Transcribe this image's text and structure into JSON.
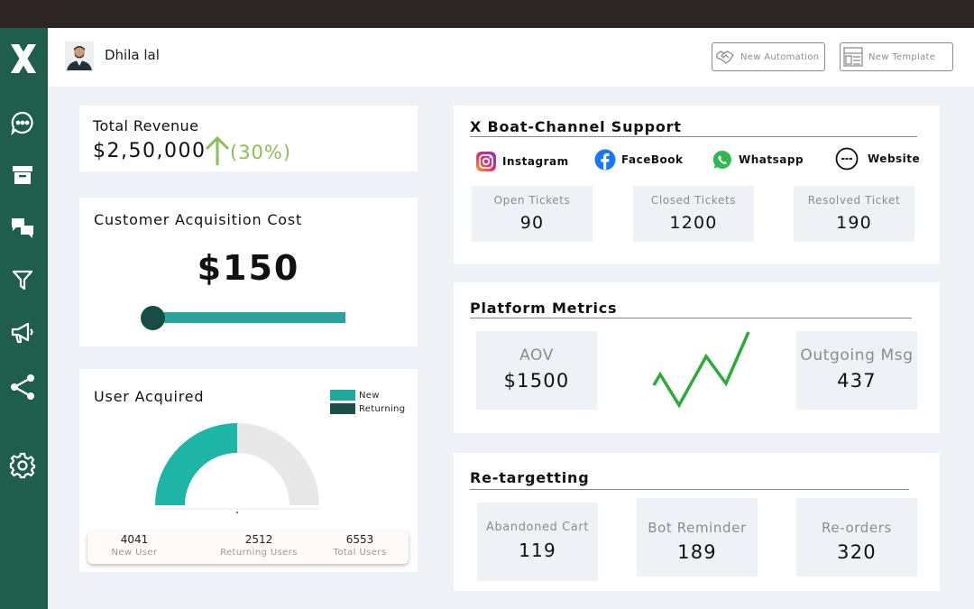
{
  "header": {
    "username": "Dhila lal",
    "buttons": {
      "new_automation": "New Automation",
      "new_template": "New Template"
    }
  },
  "sidebar": {
    "items": [
      "chat-icon",
      "archive-icon",
      "conversations-icon",
      "filter-icon",
      "megaphone-icon",
      "share-icon",
      "settings-icon"
    ]
  },
  "revenue": {
    "title": "Total Revenue",
    "amount": "$2,50,000",
    "change": "(30%)"
  },
  "cac": {
    "title": "Customer Acquisition Cost",
    "value": "$150"
  },
  "users": {
    "title": "User Acquired",
    "legend": [
      {
        "label": "New",
        "color": "#20a89c"
      },
      {
        "label": "Returning",
        "color": "#1b4f47"
      }
    ],
    "stats": [
      {
        "value": "4041",
        "label": "New User"
      },
      {
        "value": "2512",
        "label": "Returning Users"
      },
      {
        "value": "6553",
        "label": "Total Users"
      }
    ],
    "gauge_new_fraction": 0.5
  },
  "support": {
    "title": "X Boat-Channel Support",
    "channels": [
      "Instagram",
      "FaceBook",
      "Whatsapp",
      "Website"
    ],
    "tiles": [
      {
        "label": "Open Tickets",
        "value": "90"
      },
      {
        "label": "Closed Tickets",
        "value": "1200"
      },
      {
        "label": "Resolved Ticket",
        "value": "190"
      }
    ]
  },
  "platform": {
    "title": "Platform Metrics",
    "aov": {
      "label": "AOV",
      "value": "$1500"
    },
    "outgoing": {
      "label": "Outgoing Msg",
      "value": "437"
    }
  },
  "retargeting": {
    "title": "Re-targetting",
    "tiles": [
      {
        "label": "Abandoned Cart",
        "value": "119"
      },
      {
        "label": "Bot Reminder",
        "value": "189"
      },
      {
        "label": "Re-orders",
        "value": "320"
      }
    ]
  },
  "colors": {
    "sidebar": "#1f5e4b",
    "accent_green": "#8bbd59",
    "teal": "#20a89c",
    "dark_teal": "#1b4f47"
  }
}
